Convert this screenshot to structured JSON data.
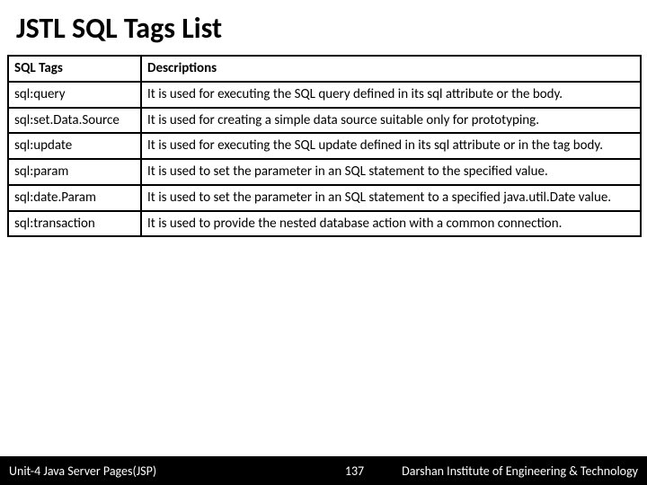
{
  "title": "JSTL SQL Tags List",
  "table": {
    "headers": {
      "col1": "SQL Tags",
      "col2": "Descriptions"
    },
    "rows": [
      {
        "tag": "sql:query",
        "desc": "It is used for executing the SQL query defined in its sql attribute or the body."
      },
      {
        "tag": "sql:set.Data.Source",
        "desc": "It is used for creating a simple data source suitable only for prototyping."
      },
      {
        "tag": "sql:update",
        "desc": "It is used for executing the SQL update defined in its sql attribute or in the tag body."
      },
      {
        "tag": "sql:param",
        "desc": "It is used to set the parameter in an SQL statement to the specified value."
      },
      {
        "tag": "sql:date.Param",
        "desc": "It is used to set the parameter in an SQL statement to a specified java.util.Date value."
      },
      {
        "tag": "sql:transaction",
        "desc": "It is used to provide the nested database action with a common connection."
      }
    ]
  },
  "footer": {
    "unit": "Unit-4 Java Server Pages(JSP)",
    "page": "137",
    "institute": "Darshan Institute of Engineering & Technology"
  }
}
